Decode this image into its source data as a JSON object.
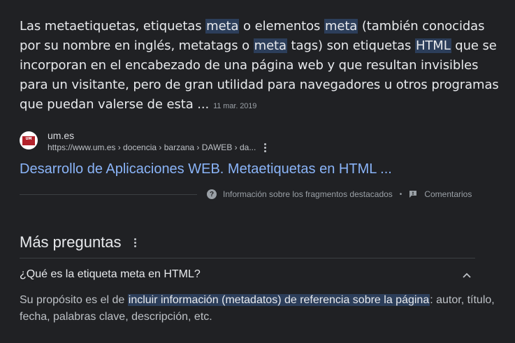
{
  "snippet": {
    "parts": [
      {
        "text": "Las metaetiquetas, etiquetas ",
        "hl": false
      },
      {
        "text": "meta",
        "hl": true
      },
      {
        "text": " o elementos ",
        "hl": false
      },
      {
        "text": "meta",
        "hl": true
      },
      {
        "text": " (también conocidas por su nombre en inglés, metatags o ",
        "hl": false
      },
      {
        "text": "meta",
        "hl": true
      },
      {
        "text": " tags) son etiquetas ",
        "hl": false
      },
      {
        "text": "HTML",
        "hl": true
      },
      {
        "text": " que se incorporan en el encabezado de una página web y que resultan invisibles para un visitante, pero de gran utilidad para navegadores u otros programas que puedan valerse de esta ...",
        "hl": false
      }
    ],
    "date": "11 mar. 2019"
  },
  "result": {
    "favicon_text": "UNIVERSIDAD DE MURCIA",
    "site_name": "um.es",
    "url": "https://www.um.es › docencia › barzana › DAWEB › da...",
    "title": "Desarrollo de Aplicaciones WEB. Metaetiquetas en HTML ..."
  },
  "feedback": {
    "info_label": "Información sobre los fragmentos destacados",
    "separator": "•",
    "comments_label": "Comentarios"
  },
  "more_questions": {
    "heading": "Más preguntas",
    "question": "¿Qué es la etiqueta meta en HTML?",
    "answer_before": "Su propósito es el de ",
    "answer_highlight": "incluir información (metadatos) de referencia sobre la página",
    "answer_after": ": autor, título, fecha, palabras clave, descripción, etc."
  },
  "icons": {
    "help": "help-circle-icon",
    "comment": "comment-icon",
    "kebab": "more-vert-icon",
    "chevron": "chevron-up-icon"
  },
  "colors": {
    "background": "#202124",
    "link": "#8ab4f8",
    "highlight": "#2c3e5a",
    "text": "#e8eaed"
  }
}
